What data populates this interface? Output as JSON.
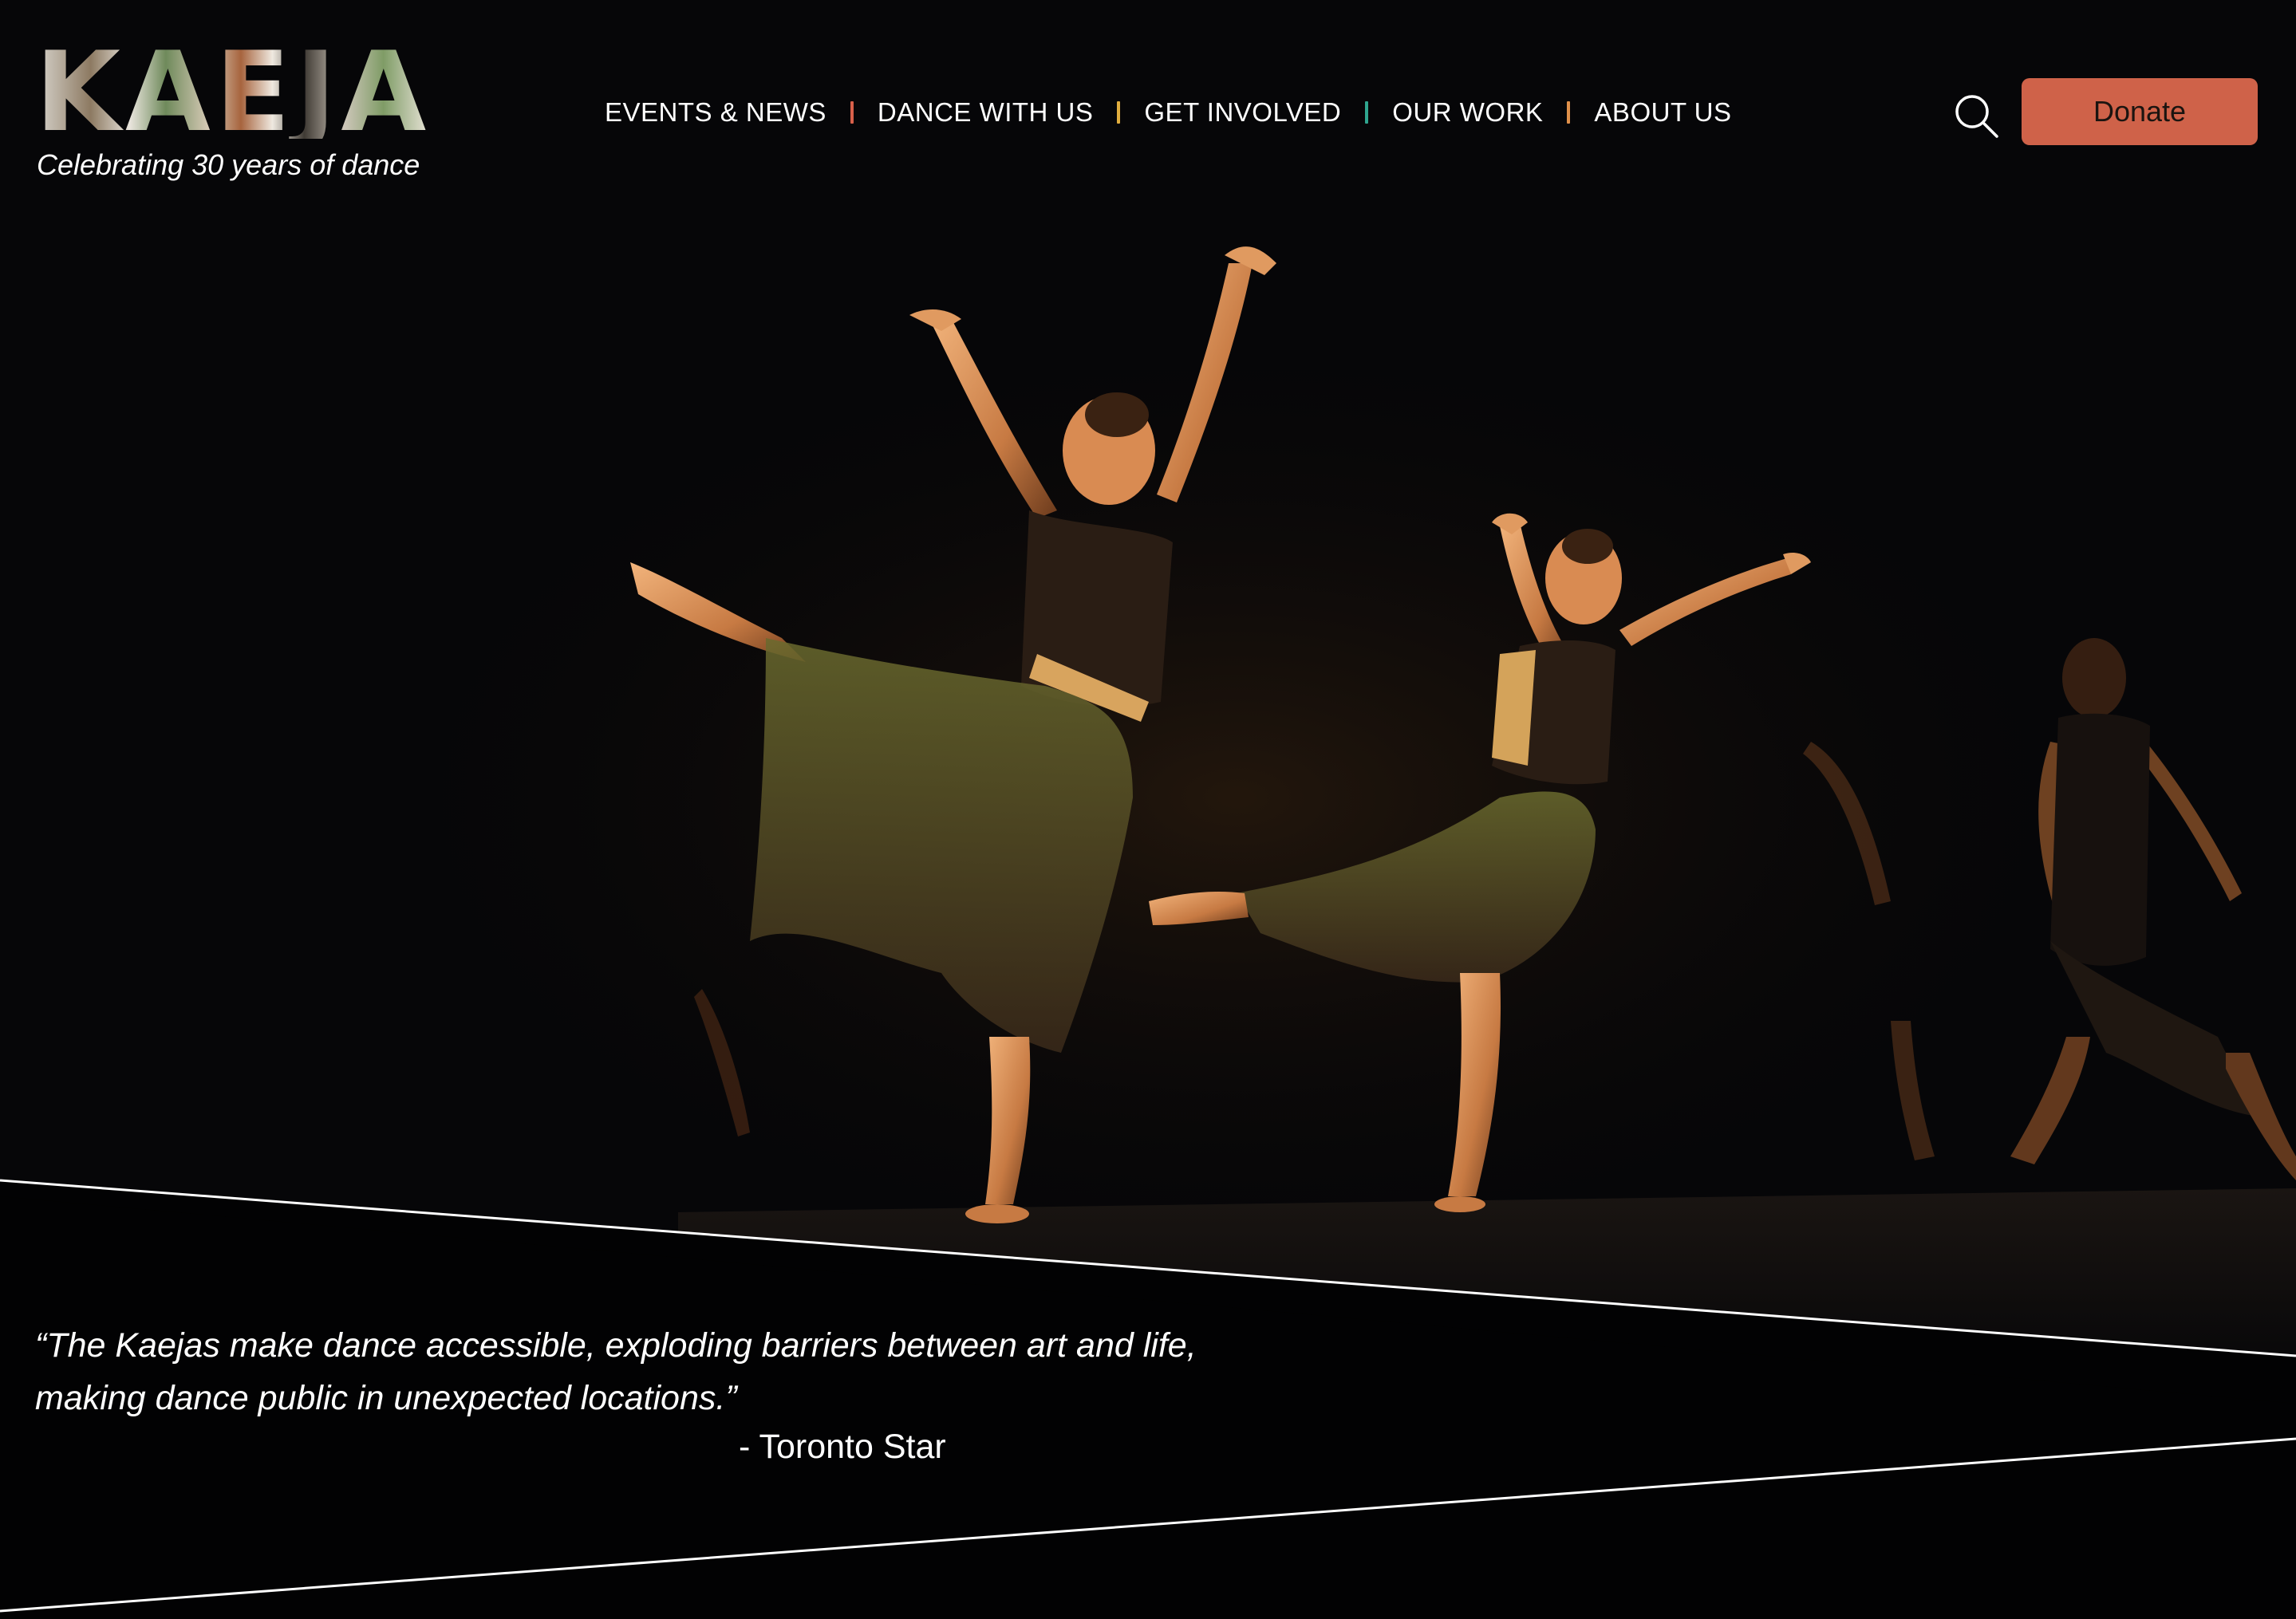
{
  "site": {
    "logo_text": "KAEJA",
    "tagline": "Celebrating 30 years of dance"
  },
  "nav": {
    "items": [
      {
        "label": "EVENTS & NEWS"
      },
      {
        "label": "DANCE WITH US"
      },
      {
        "label": "GET INVOLVED"
      },
      {
        "label": "OUR WORK"
      },
      {
        "label": "ABOUT US"
      }
    ],
    "separator_colors": [
      "#d8604a",
      "#e0ad3e",
      "#2fa58f",
      "#e0904a"
    ]
  },
  "header_actions": {
    "search_icon": "search-icon",
    "donate_label": "Donate"
  },
  "quote": {
    "line1": "“The Kaejas make dance accessible, exploding barriers between art and life,",
    "line2": "making dance public in unexpected locations.”",
    "source": "- Toronto Star"
  },
  "colors": {
    "background": "#060608",
    "accent": "#cf6249",
    "text": "#ffffff"
  }
}
